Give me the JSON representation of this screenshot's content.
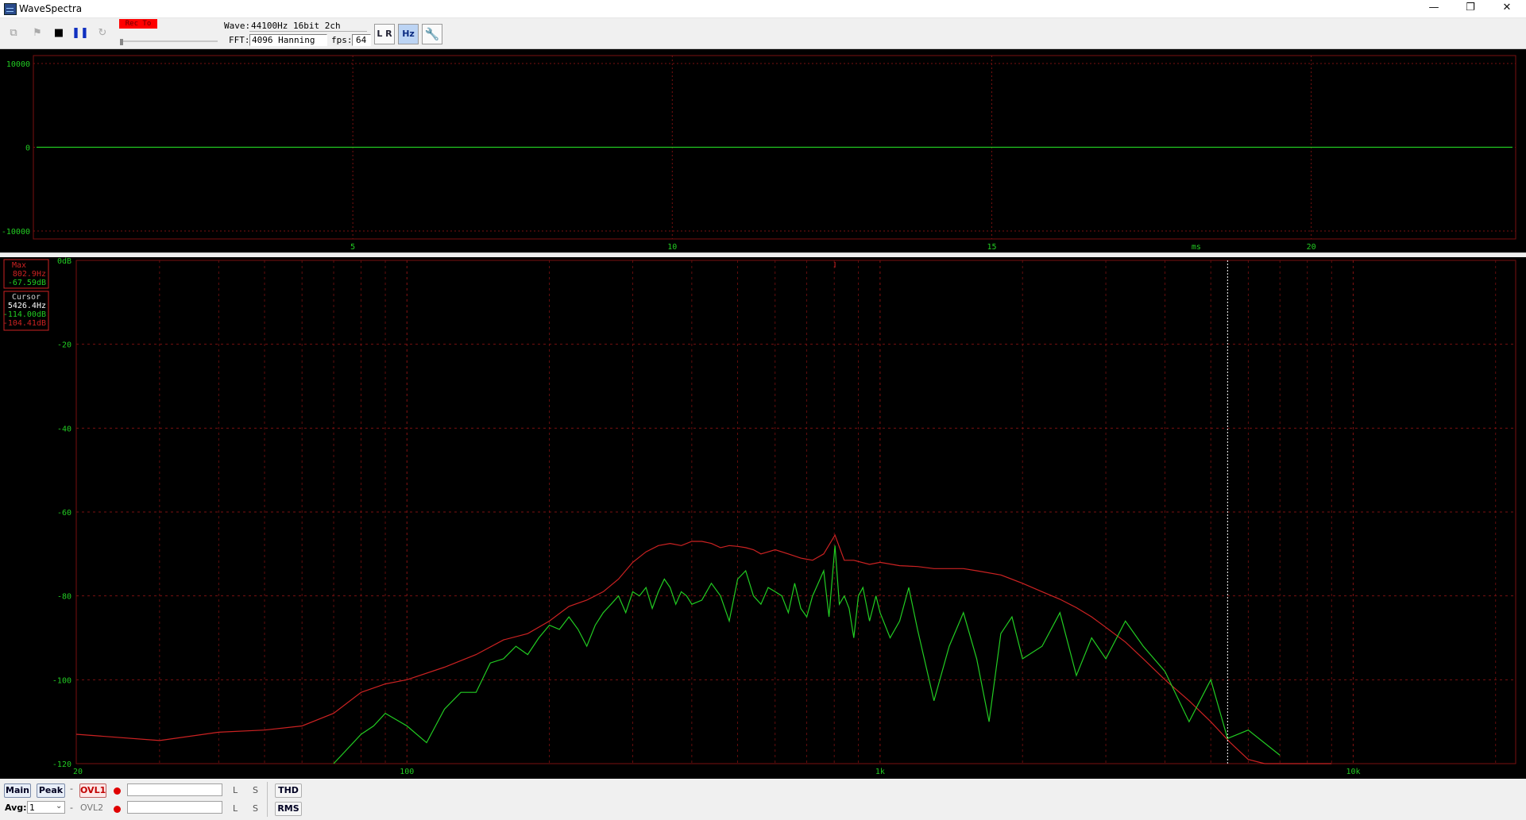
{
  "window": {
    "title": "WaveSpectra"
  },
  "toolbar": {
    "rec_to": "Rec To",
    "wave_label": "Wave:",
    "wave_value": "44100Hz 16bit 2ch",
    "fft_label": "FFT:",
    "fft_value": "4096 Hanning",
    "fps_label": "fps:",
    "fps_value": "64",
    "lr_button": "L R",
    "hz_button": "Hz"
  },
  "wave_panel": {
    "y_ticks": [
      "10000",
      "0",
      "-10000"
    ],
    "x_ticks": [
      "5",
      "10",
      "15",
      "20"
    ],
    "x_unit": "ms"
  },
  "spectrum_panel": {
    "y_ticks": [
      "0dB",
      "-20",
      "-40",
      "-60",
      "-80",
      "-100",
      "-120"
    ],
    "x_ticks": [
      "20",
      "100",
      "1k",
      "10k"
    ],
    "max_box": {
      "title": "Max",
      "freq": "802.9Hz",
      "level": "-67.59dB"
    },
    "cursor_box": {
      "title": "Cursor",
      "freq": "5426.4Hz",
      "level_l": "-114.00dB",
      "level_r": "-104.41dB"
    }
  },
  "bottom": {
    "main_btn": "Main",
    "peak_btn": "Peak",
    "dash1": "-",
    "ovl1_btn": "OVL1",
    "ovl2_label": "OVL2",
    "dash2": "-",
    "l_label": "L",
    "s_label": "S",
    "l2_label": "L",
    "s2_label": "S",
    "thd_btn": "THD",
    "rms_btn": "RMS",
    "avg_label": "Avg:",
    "avg_value": "1"
  },
  "colors": {
    "grid": "#7a1010",
    "left_channel": "#22cc22",
    "right_channel": "#cc2222",
    "axis_text": "#22cc22"
  },
  "chart_data": {
    "type": "line",
    "title": "",
    "x_scale": "log",
    "xlim": [
      20,
      22050
    ],
    "ylim": [
      -120,
      0
    ],
    "xlabel": "",
    "ylabel": "",
    "grid": true,
    "series": [
      {
        "x": [
          20,
          30,
          40,
          50,
          60,
          70,
          80,
          90,
          100,
          120,
          140,
          160,
          180,
          200,
          220,
          240,
          260,
          280,
          300,
          320,
          340,
          360,
          380,
          400,
          420,
          440,
          460,
          480,
          500,
          520,
          540,
          560,
          580,
          600,
          640,
          680,
          720,
          760,
          802.9,
          840,
          880,
          950,
          1000,
          1100,
          1200,
          1300,
          1400,
          1500,
          1600,
          1800,
          2000,
          2200,
          2400,
          2600,
          2800,
          3000,
          3300,
          3600,
          4000,
          4500,
          5000,
          5500,
          6000,
          6500,
          7000,
          7500,
          8000,
          9000
        ],
        "values": [
          -113,
          -114.5,
          -112.5,
          -112,
          -111,
          -108,
          -103,
          -101,
          -100,
          -97,
          -94,
          -90.5,
          -89,
          -86,
          -82.5,
          -81,
          -79,
          -76,
          -72,
          -69.5,
          -68,
          -67.5,
          -68,
          -67,
          -67,
          -67.5,
          -68.5,
          -68,
          -68.2,
          -68.5,
          -69,
          -70,
          -69.5,
          -69,
          -70,
          -71,
          -71.5,
          -70,
          -65.5,
          -71.5,
          -71.5,
          -72.5,
          -72,
          -72.8,
          -73,
          -73.5,
          -73.5,
          -73.5,
          -74,
          -75,
          -77,
          -79,
          -80.8,
          -82.8,
          -85,
          -87.5,
          -91,
          -95,
          -100,
          -105,
          -110,
          -115,
          -119,
          -120.5,
          -122,
          -124,
          -125,
          -126
        ]
      },
      {
        "x": [
          70,
          80,
          85,
          90,
          100,
          110,
          120,
          130,
          140,
          150,
          160,
          170,
          180,
          190,
          200,
          210,
          220,
          230,
          240,
          250,
          260,
          270,
          280,
          290,
          300,
          310,
          320,
          330,
          340,
          350,
          360,
          370,
          380,
          390,
          400,
          420,
          440,
          460,
          480,
          500,
          520,
          540,
          560,
          580,
          600,
          620,
          640,
          660,
          680,
          700,
          720,
          740,
          760,
          780,
          802.9,
          820,
          840,
          860,
          880,
          900,
          920,
          950,
          980,
          1000,
          1050,
          1100,
          1150,
          1200,
          1300,
          1400,
          1500,
          1600,
          1700,
          1800,
          1900,
          2000,
          2200,
          2400,
          2600,
          2800,
          3000,
          3300,
          3600,
          4000,
          4500,
          5000,
          5426.4,
          6000,
          7000
        ],
        "values": [
          -120,
          -113,
          -111,
          -108,
          -111,
          -115,
          -107,
          -103,
          -103,
          -96,
          -95,
          -92,
          -94,
          -90,
          -87,
          -88,
          -85,
          -88,
          -92,
          -87,
          -84,
          -82,
          -80,
          -84,
          -79,
          -80,
          -78,
          -83,
          -79,
          -76,
          -78,
          -82,
          -79,
          -80,
          -82,
          -81,
          -77,
          -80,
          -86,
          -76,
          -74,
          -80,
          -82,
          -78,
          -79,
          -80,
          -84,
          -77,
          -83,
          -85,
          -80,
          -77,
          -74,
          -85,
          -68,
          -82,
          -80,
          -83,
          -90,
          -80,
          -78,
          -86,
          -80,
          -84,
          -90,
          -86,
          -78,
          -88,
          -105,
          -92,
          -84,
          -95,
          -110,
          -89,
          -85,
          -95,
          -92,
          -84,
          -99,
          -90,
          -95,
          -86,
          -92,
          -98,
          -110,
          -100,
          -114,
          -112,
          -118
        ]
      }
    ]
  }
}
